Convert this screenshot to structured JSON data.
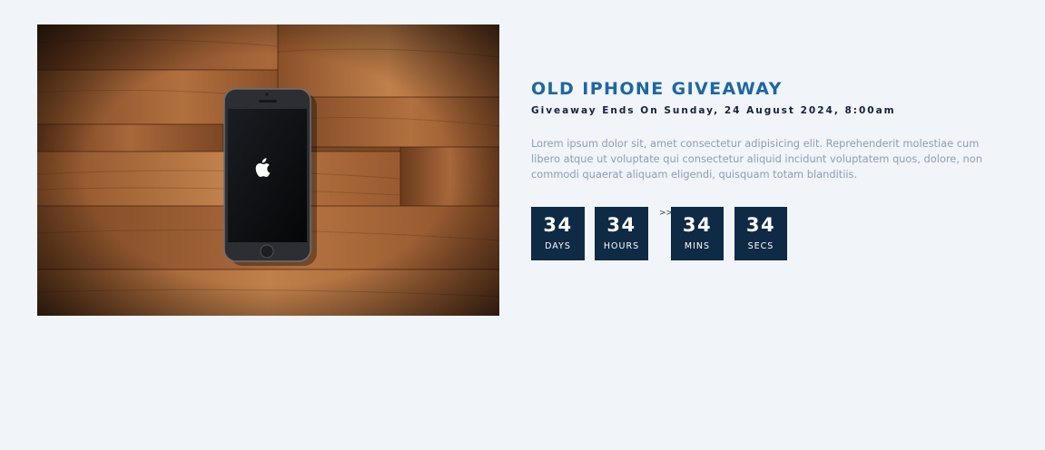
{
  "giveaway": {
    "title": "OLD IPHONE GIVEAWAY",
    "ends": "Giveaway Ends On Sunday, 24 August 2024, 8:00am",
    "description": "Lorem ipsum dolor sit, amet consectetur adipisicing elit. Reprehenderit molestiae cum libero atque ut voluptate qui consectetur aliquid incidunt voluptatem quos, dolore, non commodi quaerat aliquam eligendi, quisquam totam blanditiis."
  },
  "countdown": {
    "days": {
      "value": "34",
      "label": "DAYS"
    },
    "hours": {
      "value": "34",
      "label": "HOURS"
    },
    "separator": ">>",
    "mins": {
      "value": "34",
      "label": "MINS"
    },
    "secs": {
      "value": "34",
      "label": "SECS"
    }
  },
  "image": {
    "subject": "iphone-on-wooden-table",
    "logo": "apple-logo-icon"
  },
  "colors": {
    "background": "#f1f4f8",
    "title": "#1d67a3",
    "subtitle": "#14233b",
    "description": "#8c9fb4",
    "countdown_box": "#0f2a45",
    "countdown_text": "#ffffff"
  }
}
